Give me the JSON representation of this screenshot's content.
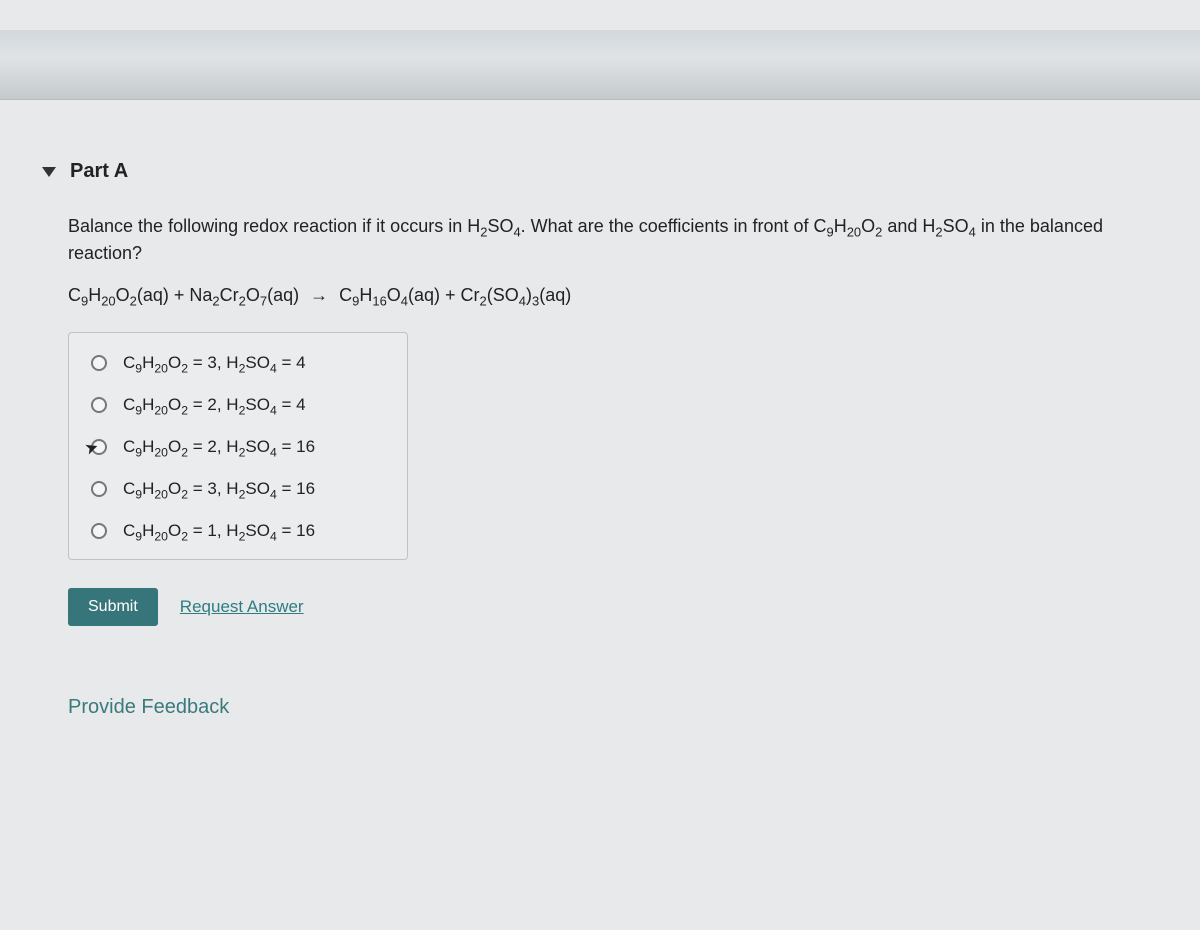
{
  "section": {
    "label": "Part A"
  },
  "question": {
    "prompt_pre": "Balance the following redox reaction if it occurs in H",
    "prompt_mid1": "SO",
    "prompt_mid2": ". What are the coefficients in front of C",
    "prompt_mid3": "H",
    "prompt_mid4": "O",
    "prompt_mid5": " and H",
    "prompt_mid6": "SO",
    "prompt_end": " in the balanced reaction?",
    "eq": {
      "r1": "C",
      "r1s1": "9",
      "r1b": "H",
      "r1s2": "20",
      "r1c": "O",
      "r1s3": "2",
      "r1ph": "(aq) + Na",
      "r1s4": "2",
      "r1d": "Cr",
      "r1s5": "2",
      "r1e": "O",
      "r1s6": "7",
      "r1ph2": "(aq)",
      "arrow": "→",
      "p1": "C",
      "p1s1": "9",
      "p1b": "H",
      "p1s2": "16",
      "p1c": "O",
      "p1s3": "4",
      "p1ph": "(aq) + Cr",
      "p1s4": "2",
      "p1d": "(SO",
      "p1s5": "4",
      "p1e": ")",
      "p1s6": "3",
      "p1ph2": "(aq)"
    }
  },
  "options": [
    {
      "c": "C",
      "s1": "9",
      "h": "H",
      "s2": "20",
      "o": "O",
      "s3": "2",
      "eq": " = 3, H",
      "s4": "2",
      "so": "SO",
      "s5": "4",
      "val": " = 4"
    },
    {
      "c": "C",
      "s1": "9",
      "h": "H",
      "s2": "20",
      "o": "O",
      "s3": "2",
      "eq": " = 2, H",
      "s4": "2",
      "so": "SO",
      "s5": "4",
      "val": " = 4"
    },
    {
      "c": "C",
      "s1": "9",
      "h": "H",
      "s2": "20",
      "o": "O",
      "s3": "2",
      "eq": " = 2, H",
      "s4": "2",
      "so": "SO",
      "s5": "4",
      "val": " = 16"
    },
    {
      "c": "C",
      "s1": "9",
      "h": "H",
      "s2": "20",
      "o": "O",
      "s3": "2",
      "eq": " = 3, H",
      "s4": "2",
      "so": "SO",
      "s5": "4",
      "val": " = 16"
    },
    {
      "c": "C",
      "s1": "9",
      "h": "H",
      "s2": "20",
      "o": "O",
      "s3": "2",
      "eq": " = 1, H",
      "s4": "2",
      "so": "SO",
      "s5": "4",
      "val": " = 16"
    }
  ],
  "actions": {
    "submit": "Submit",
    "request": "Request Answer"
  },
  "feedback": "Provide Feedback"
}
